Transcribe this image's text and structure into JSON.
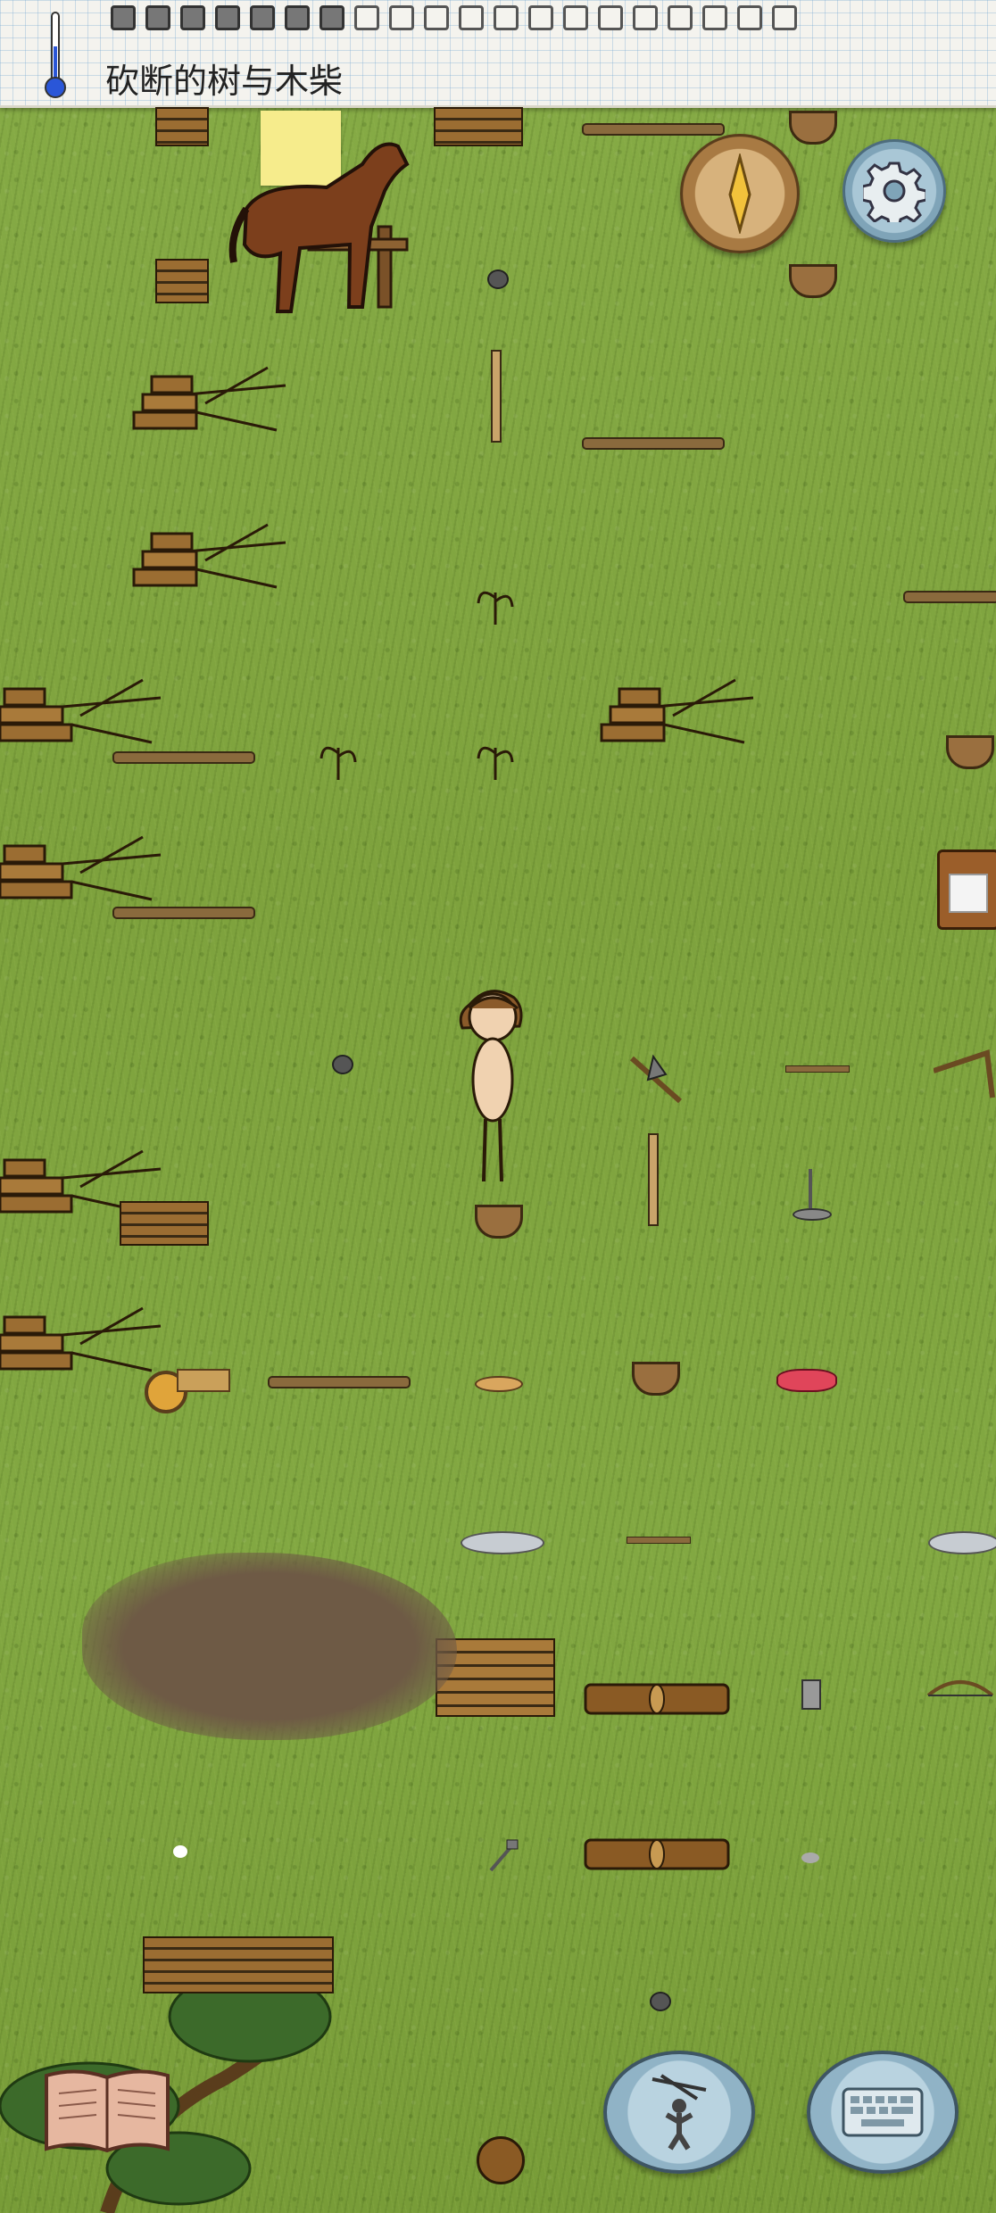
{
  "status_bar": {
    "area_title": "砍断的树与木柴",
    "thermometer_icon": "thermometer-icon",
    "craving_slots": [
      1,
      1,
      1,
      1,
      1,
      1,
      1,
      0,
      0,
      0,
      0,
      0,
      0,
      0,
      0,
      0,
      0,
      0,
      0,
      0
    ]
  },
  "buttons": {
    "compass": "compass-icon",
    "settings": "gear-icon",
    "tech_book": "book-icon",
    "emote": "puppet-icon",
    "chat": "keyboard-icon"
  },
  "colors": {
    "grass": "#82a842",
    "wood": "#8a6a3d",
    "ui_blue": "#a9c7d6",
    "paper": "#f4f3ee"
  }
}
